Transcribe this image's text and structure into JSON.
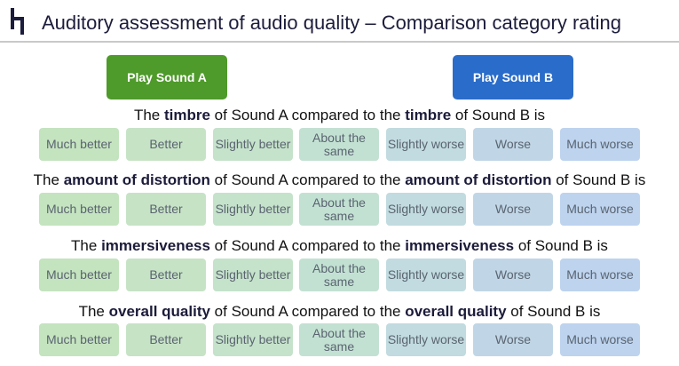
{
  "header": {
    "title": "Auditory assessment of audio quality – Comparison category rating"
  },
  "buttons": {
    "play_a": "Play Sound A",
    "play_b": "Play Sound B"
  },
  "options": [
    {
      "label": "Much better",
      "color": "#c4e3bf"
    },
    {
      "label": "Better",
      "color": "#c7e3c6"
    },
    {
      "label": "Slightly better",
      "color": "#c5e2cb"
    },
    {
      "label": "About the same",
      "color": "#c3e1d3"
    },
    {
      "label": "Slightly worse",
      "color": "#c1dbe0"
    },
    {
      "label": "Worse",
      "color": "#c0d6e6"
    },
    {
      "label": "Much worse",
      "color": "#bdd3ee"
    }
  ],
  "questions": [
    {
      "p1": "The ",
      "attr1": "timbre",
      "p2": " of Sound A compared to the ",
      "attr2": "timbre",
      "p3": " of Sound B is"
    },
    {
      "p1": "The ",
      "attr1": "amount of distortion",
      "p2": " of Sound A compared to the ",
      "attr2": "amount of distortion",
      "p3": " of Sound B is"
    },
    {
      "p1": "The ",
      "attr1": "immersiveness",
      "p2": " of Sound A compared to the ",
      "attr2": "immersiveness",
      "p3": " of Sound B is"
    },
    {
      "p1": "The ",
      "attr1": "overall quality",
      "p2": " of Sound A compared to the ",
      "attr2": "overall quality",
      "p3": " of Sound B is"
    }
  ]
}
